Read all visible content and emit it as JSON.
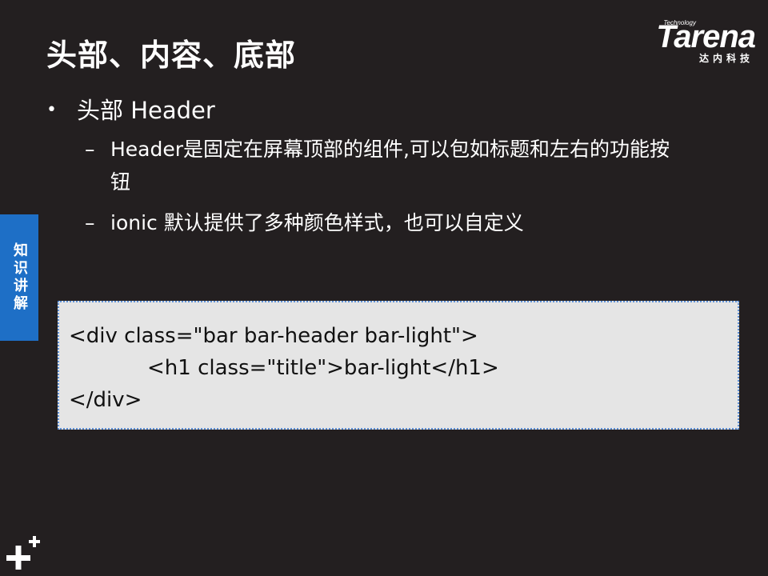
{
  "slide": {
    "title": "头部、内容、底部"
  },
  "logo": {
    "tech": "Technology",
    "word": "Tarena",
    "cn": "达内科技"
  },
  "bullets": {
    "main": "头部 Header",
    "sub": [
      "Header是固定在屏幕顶部的组件,可以包如标题和左右的功能按钮",
      "ionic 默认提供了多种颜色样式，也可以自定义"
    ]
  },
  "side_tab": {
    "label": "知识讲解"
  },
  "code": {
    "lines": [
      "<div class=\"bar bar-header bar-light\">",
      "<h1 class=\"title\">bar-light</h1>",
      "</div>"
    ]
  },
  "icons": {
    "bullet": "bullet-dot-icon",
    "dash": "dash-icon",
    "corner": "plus-icon"
  },
  "colors": {
    "background": "#231f20",
    "side_tab": "#1e6fc6",
    "code_background": "#e5e5e5",
    "code_border": "#5b8fd6"
  }
}
